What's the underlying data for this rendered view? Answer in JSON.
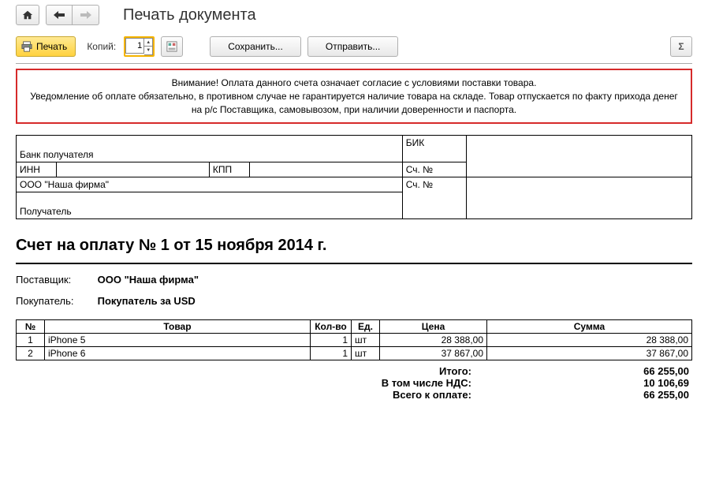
{
  "header": {
    "title": "Печать документа"
  },
  "toolbar": {
    "print_label": "Печать",
    "copies_label": "Копий:",
    "copies_value": "1",
    "save_label": "Сохранить...",
    "send_label": "Отправить...",
    "sigma_label": "Σ"
  },
  "warning": {
    "line1": "Внимание! Оплата данного счета означает согласие с условиями поставки товара.",
    "line2": "Уведомление об оплате обязательно, в противном случае не гарантируется наличие товара на складе. Товар отпускается по факту прихода денег на р/с Поставщика, самовывозом, при наличии доверенности и паспорта."
  },
  "bank": {
    "recipient_bank_label": "Банк получателя",
    "bik_label": "БИК",
    "acc_label": "Сч. №",
    "inn_label": "ИНН",
    "kpp_label": "КПП",
    "recipient_name": "ООО \"Наша фирма\"",
    "recipient_label": "Получатель"
  },
  "doc_title": "Счет на оплату № 1 от 15 ноября 2014 г.",
  "supplier_label": "Поставщик:",
  "supplier_value": "ООО \"Наша фирма\"",
  "buyer_label": "Покупатель:",
  "buyer_value": "Покупатель за USD",
  "columns": {
    "num": "№",
    "name": "Товар",
    "qty": "Кол-во",
    "unit": "Ед.",
    "price": "Цена",
    "sum": "Сумма"
  },
  "items": [
    {
      "num": "1",
      "name": "iPhone 5",
      "qty": "1",
      "unit": "шт",
      "price": "28 388,00",
      "sum": "28 388,00"
    },
    {
      "num": "2",
      "name": "iPhone 6",
      "qty": "1",
      "unit": "шт",
      "price": "37 867,00",
      "sum": "37 867,00"
    }
  ],
  "totals": {
    "subtotal_label": "Итого:",
    "subtotal_value": "66 255,00",
    "vat_label": "В том числе НДС:",
    "vat_value": "10 106,69",
    "grand_label": "Всего к оплате:",
    "grand_value": "66 255,00"
  }
}
